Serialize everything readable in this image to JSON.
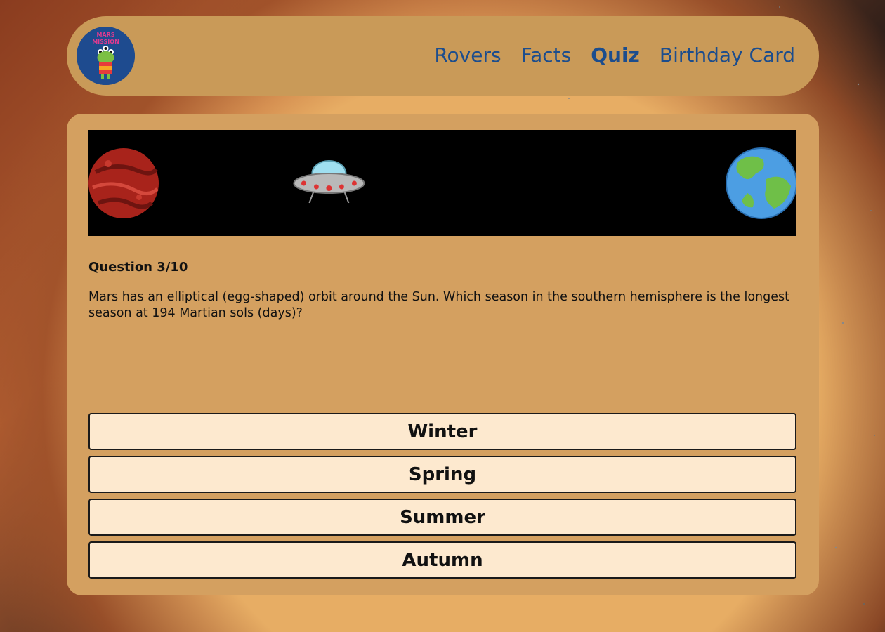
{
  "header": {
    "logo_icon": "mars-mission-alien-logo",
    "logo_text": "MARS MISSION",
    "nav": [
      {
        "label": "Rovers"
      },
      {
        "label": "Facts"
      },
      {
        "label": "Quiz",
        "active": true
      },
      {
        "label": "Birthday Card"
      }
    ]
  },
  "quiz": {
    "progress_icons": [
      "mars-planet-icon",
      "ufo-icon",
      "earth-planet-icon"
    ],
    "progress_fraction": 0.3,
    "question_number": "Question 3/10",
    "question_text": "Mars has an elliptical (egg-shaped) orbit around the Sun. Which season in the southern hemisphere is the longest season at 194 Martian sols (days)?",
    "answers": [
      "Winter",
      "Spring",
      "Summer",
      "Autumn"
    ]
  },
  "colors": {
    "nav_link": "#1c4d8d",
    "panel": "#d4a060",
    "answer_bg": "#fde9cf"
  }
}
